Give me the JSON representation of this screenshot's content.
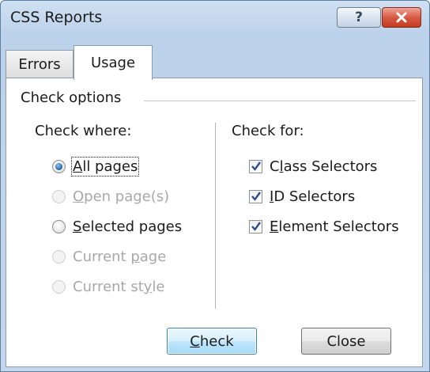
{
  "window": {
    "title": "CSS Reports",
    "help_button": "?",
    "close_button_icon": "close-x-icon"
  },
  "tabs": [
    {
      "label": "Errors",
      "selected": false
    },
    {
      "label": "Usage",
      "selected": true
    }
  ],
  "check_options": {
    "group_label": "Check options",
    "check_where": {
      "heading": "Check where:",
      "options": [
        {
          "pre": "",
          "key": "A",
          "post": "ll pages",
          "selected": true,
          "enabled": true
        },
        {
          "pre": "",
          "key": "O",
          "post": "pen page(s)",
          "selected": false,
          "enabled": false
        },
        {
          "pre": "",
          "key": "S",
          "post": "elected pages",
          "selected": false,
          "enabled": true
        },
        {
          "pre": "Current ",
          "key": "p",
          "post": "age",
          "selected": false,
          "enabled": false
        },
        {
          "pre": "Current st",
          "key": "y",
          "post": "le",
          "selected": false,
          "enabled": false
        }
      ]
    },
    "check_for": {
      "heading": "Check for:",
      "options": [
        {
          "pre": "C",
          "key": "l",
          "post": "ass Selectors",
          "checked": true
        },
        {
          "pre": "",
          "key": "I",
          "post": "D Selectors",
          "checked": true
        },
        {
          "pre": "",
          "key": "E",
          "post": "lement Selectors",
          "checked": true
        }
      ]
    }
  },
  "buttons": {
    "check": {
      "pre": "",
      "key": "C",
      "post": "heck"
    },
    "close": {
      "label": "Close"
    }
  },
  "colors": {
    "title_bar": "#bcd1ea",
    "close_button": "#d85b43",
    "default_button_border": "#3c7fb1",
    "disabled_text": "#a8a8a8"
  }
}
